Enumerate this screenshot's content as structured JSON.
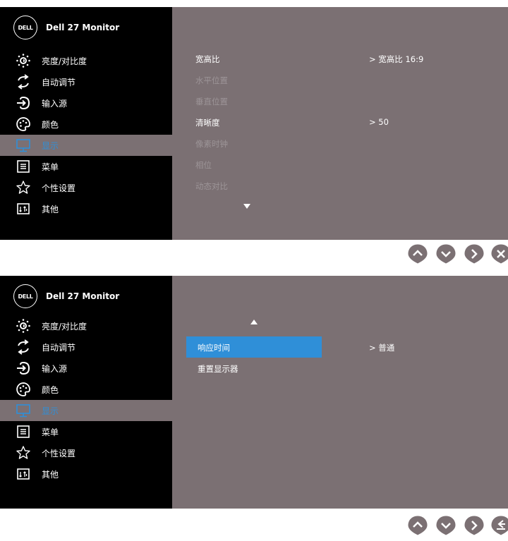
{
  "brand": {
    "logo": "DELL",
    "model": "Dell 27 Monitor"
  },
  "menu": [
    {
      "label": "亮度/对比度",
      "icon": "brightness-icon"
    },
    {
      "label": "自动调节",
      "icon": "auto-adjust-icon"
    },
    {
      "label": "输入源",
      "icon": "input-source-icon"
    },
    {
      "label": "颜色",
      "icon": "color-palette-icon"
    },
    {
      "label": "显示",
      "icon": "monitor-icon",
      "selected": true
    },
    {
      "label": "菜单",
      "icon": "menu-icon"
    },
    {
      "label": "个性设置",
      "icon": "star-icon"
    },
    {
      "label": "其他",
      "icon": "others-icon"
    }
  ],
  "top": {
    "options": [
      {
        "label": "宽高比",
        "value": "> 宽高比 16:9",
        "enabled": true
      },
      {
        "label": "水平位置",
        "enabled": false
      },
      {
        "label": "垂直位置",
        "enabled": false
      },
      {
        "label": "清晰度",
        "value": "> 50",
        "enabled": true
      },
      {
        "label": "像素时钟",
        "enabled": false
      },
      {
        "label": "相位",
        "enabled": false
      },
      {
        "label": "动态对比",
        "enabled": false
      }
    ],
    "buttons": [
      "up-icon",
      "down-icon",
      "right-icon",
      "close-icon"
    ]
  },
  "bottom": {
    "options": [
      {
        "label": "响应时间",
        "value": "> 普通",
        "selected": true
      },
      {
        "label": "重置显示器"
      }
    ],
    "buttons": [
      "up-icon",
      "down-icon",
      "right-icon",
      "back-icon"
    ]
  },
  "colors": {
    "panel": "#000000",
    "content": "#7b7073",
    "highlight": "#2f8fd8",
    "button": "#7b7073"
  }
}
